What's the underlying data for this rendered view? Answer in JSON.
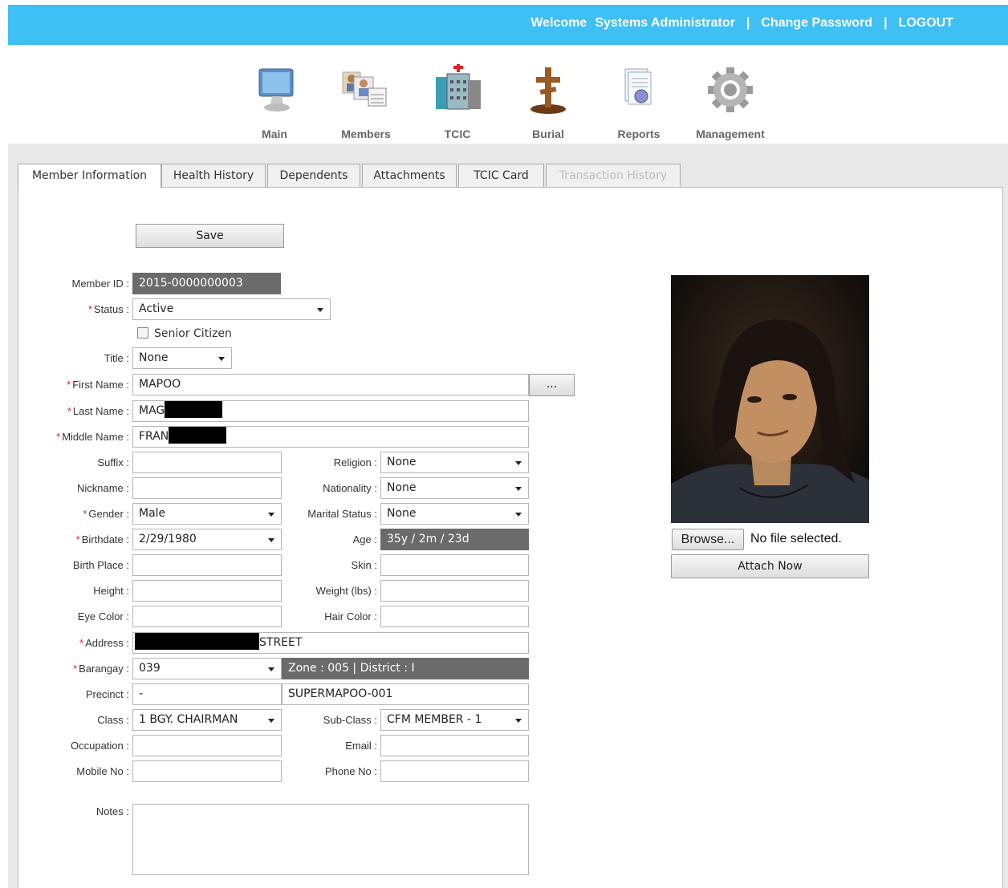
{
  "header": {
    "welcome": "Welcome",
    "user": "Systems Administrator",
    "separator": "|",
    "change_password": "Change Password",
    "logout": "LOGOUT",
    "bar_color": "#3fc0f4"
  },
  "nav": [
    {
      "label": "Main",
      "icon": "monitor-icon"
    },
    {
      "label": "Members",
      "icon": "members-icon"
    },
    {
      "label": "TCIC",
      "icon": "hospital-building-icon"
    },
    {
      "label": "Burial",
      "icon": "cross-icon"
    },
    {
      "label": "Reports",
      "icon": "report-document-icon"
    },
    {
      "label": "Management",
      "icon": "gear-icon"
    }
  ],
  "tabs": [
    {
      "label": "Member Information",
      "state": "active"
    },
    {
      "label": "Health History",
      "state": "normal"
    },
    {
      "label": "Dependents",
      "state": "normal"
    },
    {
      "label": "Attachments",
      "state": "normal"
    },
    {
      "label": "TCIC Card",
      "state": "normal"
    },
    {
      "label": "Transaction History",
      "state": "disabled"
    }
  ],
  "form": {
    "save_label": "Save",
    "member_id": {
      "label": "Member ID :",
      "value": "2015-0000000003"
    },
    "status": {
      "label": "Status :",
      "value": "Active"
    },
    "senior_citizen": {
      "label": "Senior Citizen",
      "checked": false
    },
    "title": {
      "label": "Title :",
      "value": "None"
    },
    "first_name": {
      "label": "First Name :",
      "value": "MAPOO",
      "lookup": "..."
    },
    "last_name": {
      "label": "Last Name :",
      "value": "MAG"
    },
    "middle_name": {
      "label": "Middle Name :",
      "value": "FRAN"
    },
    "suffix": {
      "label": "Suffix :",
      "value": ""
    },
    "religion": {
      "label": "Religion :",
      "value": "None"
    },
    "nickname": {
      "label": "Nickname :",
      "value": ""
    },
    "nationality": {
      "label": "Nationality :",
      "value": "None"
    },
    "gender": {
      "label": "Gender :",
      "value": "Male"
    },
    "marital_status": {
      "label": "Marital Status :",
      "value": "None"
    },
    "birthdate": {
      "label": "Birthdate :",
      "value": "2/29/1980"
    },
    "age": {
      "label": "Age :",
      "value": "35y / 2m / 23d"
    },
    "birth_place": {
      "label": "Birth Place :",
      "value": ""
    },
    "skin": {
      "label": "Skin :",
      "value": ""
    },
    "height": {
      "label": "Height :",
      "value": ""
    },
    "weight": {
      "label": "Weight (lbs) :",
      "value": ""
    },
    "eye_color": {
      "label": "Eye Color :",
      "value": ""
    },
    "hair_color": {
      "label": "Hair Color :",
      "value": ""
    },
    "address": {
      "label": "Address :",
      "value": "STREET"
    },
    "barangay": {
      "label": "Barangay :",
      "value": "039",
      "zone_district": "Zone : 005 | District : I"
    },
    "precinct": {
      "label": "Precinct :",
      "value": "-",
      "code": "SUPERMAPOO-001"
    },
    "class": {
      "label": "Class :",
      "value": "1 BGY. CHAIRMAN"
    },
    "sub_class": {
      "label": "Sub-Class :",
      "value": "CFM MEMBER - 1"
    },
    "occupation": {
      "label": "Occupation :",
      "value": ""
    },
    "email": {
      "label": "Email :",
      "value": ""
    },
    "mobile_no": {
      "label": "Mobile No :",
      "value": ""
    },
    "phone_no": {
      "label": "Phone No :",
      "value": ""
    },
    "notes": {
      "label": "Notes :",
      "value": ""
    }
  },
  "photo": {
    "browse_label": "Browse...",
    "file_status": "No file selected.",
    "attach_label": "Attach Now"
  }
}
